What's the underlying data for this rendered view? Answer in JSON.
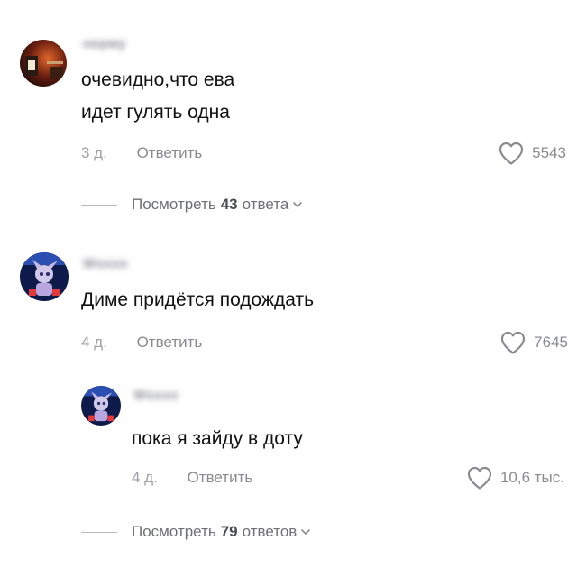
{
  "comments": [
    {
      "username": "нерму",
      "avatar_icon": "user-avatar-photo",
      "lines": [
        "очевидно,что ева",
        "идет гулять одна"
      ],
      "time": "3 д.",
      "reply_label": "Ответить",
      "likes": "5543",
      "view_replies": {
        "prefix": "Посмотреть",
        "count": "43",
        "suffix": "ответа"
      }
    },
    {
      "username": "Wsxxx",
      "avatar_icon": "user-avatar-cartoon",
      "lines": [
        "Диме придётся подождать"
      ],
      "time": "4 д.",
      "reply_label": "Ответить",
      "likes": "7645",
      "replies": [
        {
          "username": "Wsxxx",
          "avatar_icon": "user-avatar-cartoon",
          "lines": [
            "пока я зайду в доту"
          ],
          "time": "4 д.",
          "reply_label": "Ответить",
          "likes": "10,6 тыс."
        }
      ],
      "view_replies": {
        "prefix": "Посмотреть",
        "count": "79",
        "suffix": "ответов"
      }
    }
  ],
  "colors": {
    "text": "#111111",
    "muted": "#8a8b91",
    "background": "#ffffff"
  }
}
